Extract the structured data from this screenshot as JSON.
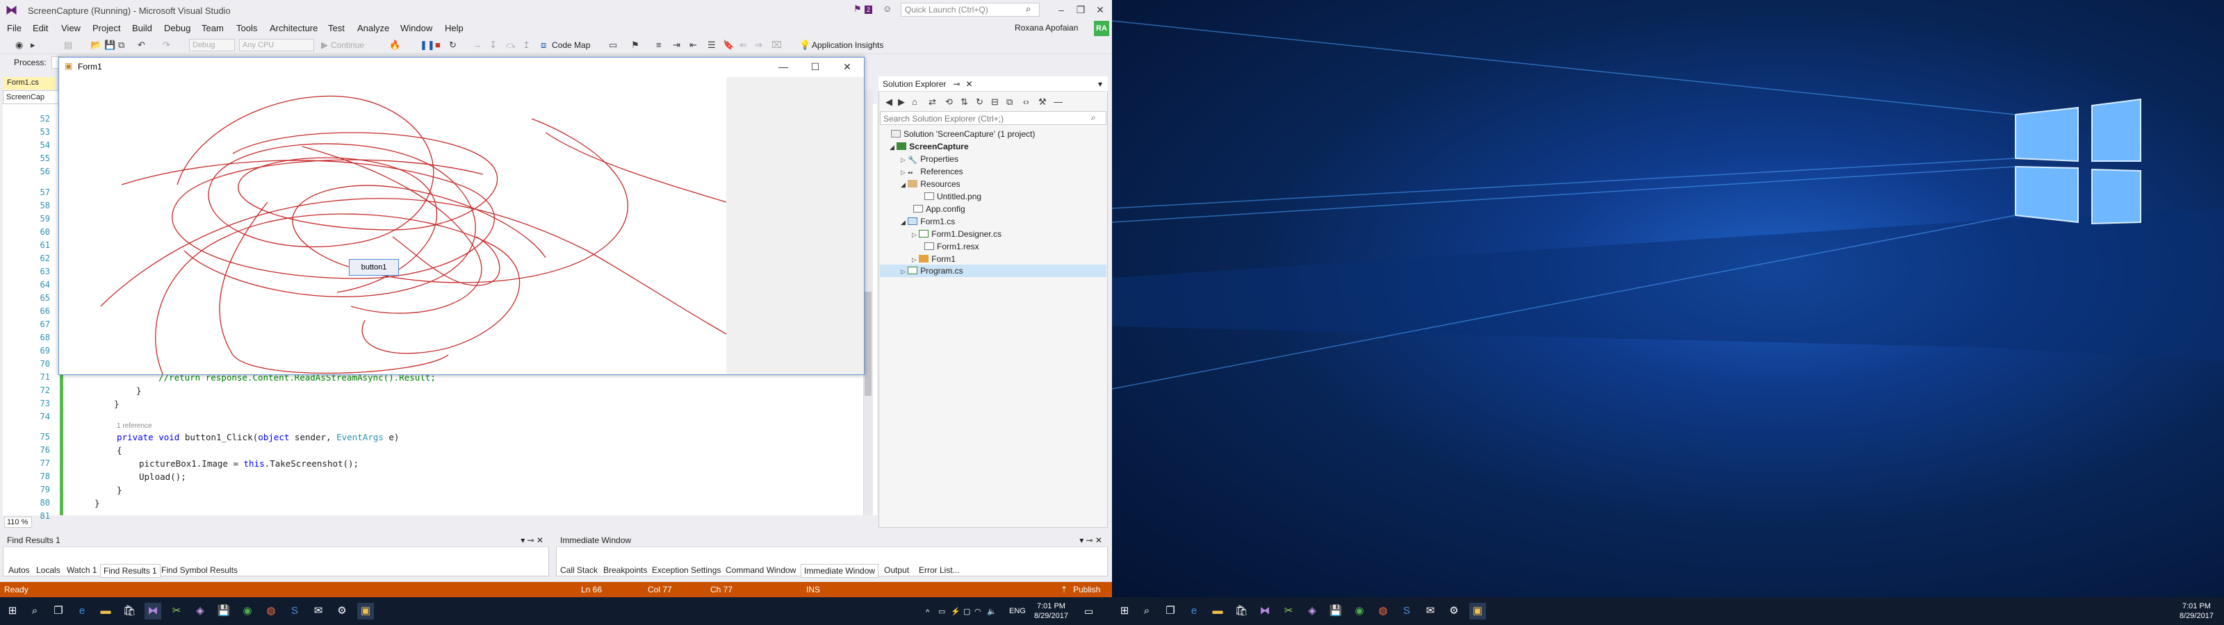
{
  "vs": {
    "title": "ScreenCapture (Running) - Microsoft Visual Studio",
    "notification_count": "2",
    "quick_launch_placeholder": "Quick Launch (Ctrl+Q)",
    "menu": [
      "File",
      "Edit",
      "View",
      "Project",
      "Build",
      "Debug",
      "Team",
      "Tools",
      "Architecture",
      "Test",
      "Analyze",
      "Window",
      "Help"
    ],
    "user_name": "Roxana Apofaian",
    "user_initials": "RA",
    "toolbar": {
      "config": "Debug",
      "platform": "Any CPU",
      "continue": "Continue",
      "code_map": "Code Map",
      "app_insights": "Application Insights"
    },
    "process_label": "Process:",
    "doc_tab": "Form1.cs",
    "nav_combo": "ScreenCap",
    "zoom": "110 %",
    "code_lines": [
      {
        "num": "71",
        "text": "            //return response.Content.ReadAsStreamAsync().Result;"
      },
      {
        "num": "72",
        "text": "        }"
      },
      {
        "num": "73",
        "text": "    }"
      },
      {
        "num": "74",
        "text": ""
      },
      {
        "num": "75",
        "text": "    private void button1_Click(object sender, EventArgs e)"
      },
      {
        "num": "76",
        "text": "    {"
      },
      {
        "num": "77",
        "text": "        pictureBox1.Image = this.TakeScreenshot();"
      },
      {
        "num": "78",
        "text": "        Upload();"
      },
      {
        "num": "79",
        "text": "    }"
      },
      {
        "num": "80",
        "text": "}"
      },
      {
        "num": "81",
        "text": ""
      }
    ],
    "hidden_line_numbers": [
      "52",
      "53",
      "54",
      "55",
      "56",
      "57",
      "58",
      "59",
      "60",
      "61",
      "62",
      "63",
      "64",
      "65",
      "66",
      "67",
      "68",
      "69",
      "70"
    ],
    "reference_hint": "1 reference",
    "code": {
      "l71_comment": "//return response.Content.ReadAsStreamAsync().Result;",
      "l72": "}",
      "l73": "}",
      "l75_private": "private",
      "l75_void": "void",
      "l75_name": " button1_Click(",
      "l75_object": "object",
      "l75_sender": " sender, ",
      "l75_type": "EventArgs",
      "l75_end": " e)",
      "l76": "{",
      "l77_a": "pictureBox1.Image = ",
      "l77_this": "this",
      "l77_b": ".TakeScreenshot();",
      "l78": "Upload();",
      "l79": "}",
      "l80": "}"
    },
    "solution_explorer": {
      "title": "Solution Explorer",
      "search_placeholder": "Search Solution Explorer (Ctrl+;)",
      "items": [
        {
          "label": "Solution 'ScreenCapture' (1 project)",
          "icon": "solution-icon"
        },
        {
          "label": "ScreenCapture",
          "icon": "csharp-project-icon"
        },
        {
          "label": "Properties",
          "icon": "wrench-icon"
        },
        {
          "label": "References",
          "icon": "references-icon"
        },
        {
          "label": "Resources",
          "icon": "folder-icon"
        },
        {
          "label": "Untitled.png",
          "icon": "image-file-icon"
        },
        {
          "label": "App.config",
          "icon": "config-file-icon"
        },
        {
          "label": "Form1.cs",
          "icon": "form-icon"
        },
        {
          "label": "Form1.Designer.cs",
          "icon": "csharp-file-icon"
        },
        {
          "label": "Form1.resx",
          "icon": "resx-file-icon"
        },
        {
          "label": "Form1",
          "icon": "class-icon"
        },
        {
          "label": "Program.cs",
          "icon": "csharp-file-icon"
        }
      ]
    },
    "find_panel_title": "Find Results 1",
    "immediate_title": "Immediate Window",
    "bottom_tabs_left": [
      "Autos",
      "Locals",
      "Watch 1",
      "Find Results 1",
      "Find Symbol Results"
    ],
    "bottom_tabs_right": [
      "Call Stack",
      "Breakpoints",
      "Exception Settings",
      "Command Window",
      "Immediate Window",
      "Output",
      "Error List..."
    ],
    "status": {
      "ready": "Ready",
      "ln": "Ln 66",
      "col": "Col 77",
      "ch": "Ch 77",
      "ins": "INS",
      "publish": "Publish"
    }
  },
  "form1": {
    "title": "Form1",
    "button_label": "button1"
  },
  "taskbar": {
    "lang": "ENG",
    "time": "7:01 PM",
    "date": "8/29/2017"
  },
  "colors": {
    "vs_accent": "#68217a",
    "status_bar": "#ca5100",
    "scribble": "#c62828"
  }
}
